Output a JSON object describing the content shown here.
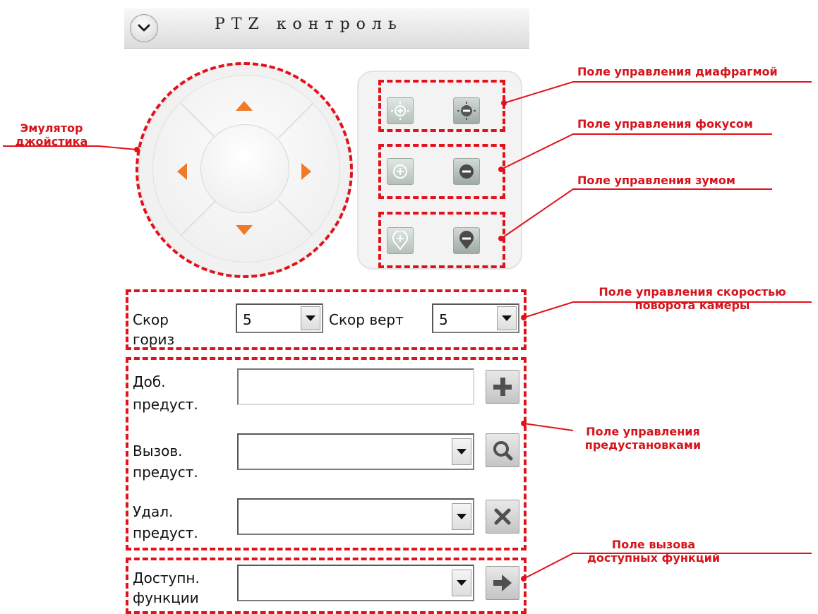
{
  "header": {
    "title": "PTZ контроль"
  },
  "speed": {
    "horizontal_label_line1": "Скор",
    "horizontal_label_line2": "гориз",
    "horizontal_value": "5",
    "vertical_label": "Скор верт",
    "vertical_value": "5"
  },
  "presets": {
    "add_label_line1": "Доб.",
    "add_label_line2": "предуст.",
    "call_label_line1": "Вызов.",
    "call_label_line2": "предуст.",
    "delete_label_line1": "Удал.",
    "delete_label_line2": "предуст.",
    "add_value": "",
    "call_value": "",
    "delete_value": ""
  },
  "functions": {
    "label_line1": "Доступн.",
    "label_line2": "функции",
    "value": ""
  },
  "annotations": {
    "joystick_line1": "Эмулятор",
    "joystick_line2": "джойстика",
    "iris": "Поле управления диафрагмой",
    "focus": "Поле управления фокусом",
    "zoom": "Поле управления зумом",
    "speed_line1": "Поле управления скоростью",
    "speed_line2": "поворота камеры",
    "presets_line1": "Поле управления",
    "presets_line2": "предустановками",
    "functions_line1": "Поле вызова",
    "functions_line2": "доступных функций"
  },
  "colors": {
    "annotation": "#e2121c",
    "arrow": "#f07a27"
  },
  "icons": {
    "collapse": "chevron-down-icon",
    "iris_plus": "iris-open-icon",
    "iris_minus": "iris-close-icon",
    "focus_plus": "focus-near-icon",
    "focus_minus": "focus-far-icon",
    "zoom_plus": "zoom-in-icon",
    "zoom_minus": "zoom-out-icon",
    "add_preset": "plus-icon",
    "call_preset": "search-icon",
    "delete_preset": "close-icon",
    "run_function": "arrow-right-icon"
  }
}
